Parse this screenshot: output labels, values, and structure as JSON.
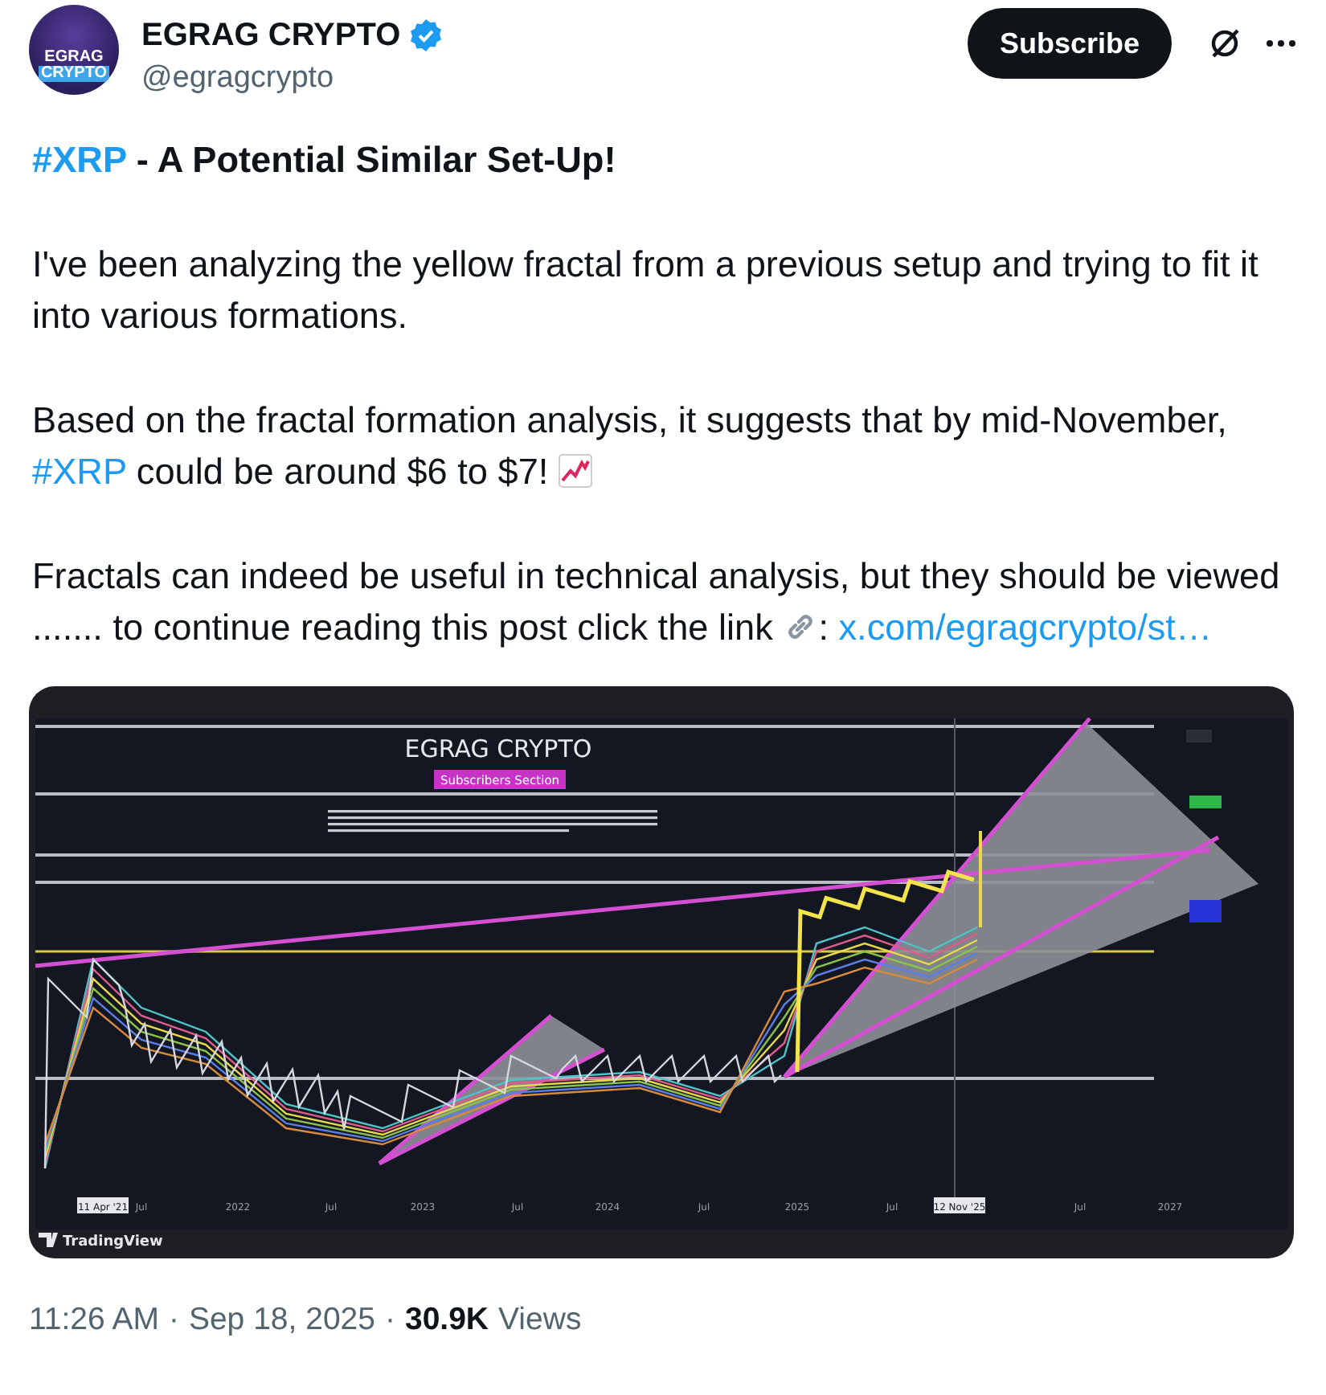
{
  "author": {
    "avatar": {
      "line1": "EGRAG",
      "line2": "CRYPTO"
    },
    "name": "EGRAG CRYPTO",
    "verified": true,
    "handle": "@egragcrypto",
    "subscribe": "Subscribe"
  },
  "title": [
    {
      "kind": "hashtag",
      "text": "#XRP"
    },
    {
      "kind": "text",
      "text": " - A Potential Similar Set-Up!"
    }
  ],
  "paragraphs": [
    {
      "parts": [
        {
          "kind": "text",
          "text": "I've been analyzing the yellow fractal from a previous setup and trying to fit it into various formations."
        }
      ]
    },
    {
      "parts": [
        {
          "kind": "text",
          "text": "Based on the fractal formation analysis, it suggests that by mid-November, "
        },
        {
          "kind": "hashtag",
          "text": "#XRP"
        },
        {
          "kind": "text",
          "text": " could be around $6 to $7! "
        },
        {
          "kind": "emoji-chart"
        }
      ]
    },
    {
      "parts": [
        {
          "kind": "text",
          "text": "Fractals can indeed be useful in technical analysis, but they should be viewed ....... to continue reading this post click the link "
        },
        {
          "kind": "emoji-link"
        },
        {
          "kind": "text",
          "text": ": "
        },
        {
          "kind": "link",
          "text": "x.com/egragcrypto/st…"
        }
      ]
    }
  ],
  "chart": {
    "title": "EGRAG CRYPTO",
    "badge": "Subscribers Section",
    "brand": "TradingView",
    "x_labels": [
      {
        "text": "11 Apr '21",
        "kind": "marker"
      },
      {
        "text": "Jul",
        "kind": "tick"
      },
      {
        "text": "2022",
        "kind": "tick"
      },
      {
        "text": "Jul",
        "kind": "tick"
      },
      {
        "text": "2023",
        "kind": "tick"
      },
      {
        "text": "Jul",
        "kind": "tick"
      },
      {
        "text": "2024",
        "kind": "tick"
      },
      {
        "text": "Jul",
        "kind": "tick"
      },
      {
        "text": "2025",
        "kind": "tick"
      },
      {
        "text": "Jul",
        "kind": "tick"
      },
      {
        "text": "12 Nov '25",
        "kind": "marker"
      },
      {
        "text": "Jul",
        "kind": "tick"
      },
      {
        "text": "2027",
        "kind": "tick"
      }
    ]
  },
  "meta": [
    {
      "kind": "text",
      "text": "11:26 AM"
    },
    {
      "kind": "sep",
      "text": "·"
    },
    {
      "kind": "text",
      "text": "Sep 18, 2025"
    },
    {
      "kind": "sep",
      "text": "·"
    },
    {
      "kind": "count",
      "text": "30.9K"
    },
    {
      "kind": "text",
      "text": "Views"
    }
  ]
}
